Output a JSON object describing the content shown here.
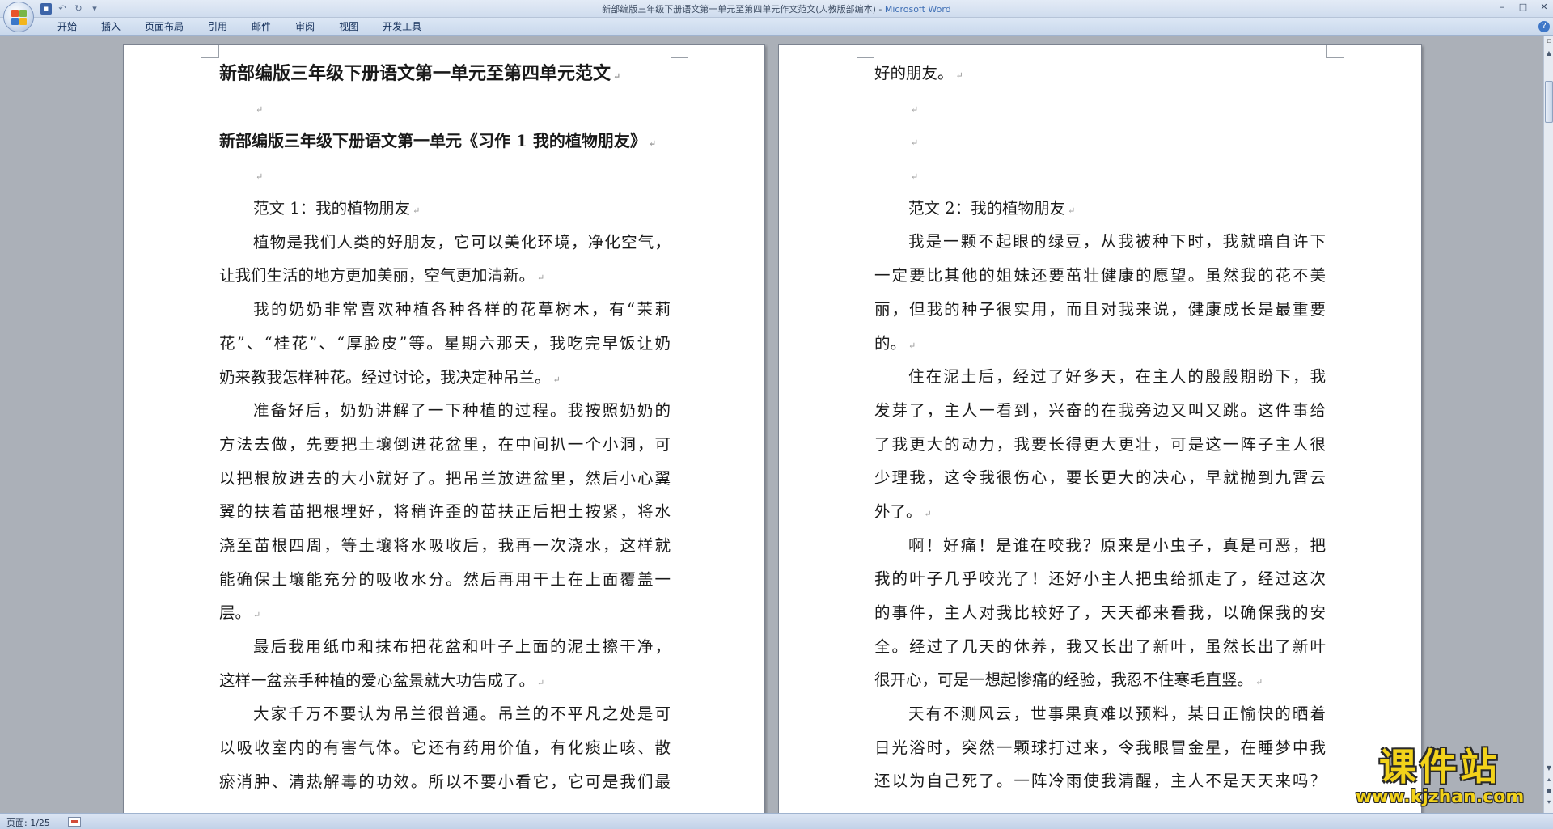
{
  "window": {
    "title": "新部编版三年级下册语文第一单元至第四单元作文范文(人教版部编本)",
    "app_name": "Microsoft Word",
    "separator": " - ",
    "minimize": "–",
    "maximize": "□",
    "close": "✕"
  },
  "quick_access": {
    "save": "▪",
    "undo": "↶",
    "redo": "↻",
    "customize": "▾"
  },
  "ribbon": {
    "tabs": [
      "开始",
      "插入",
      "页面布局",
      "引用",
      "邮件",
      "审阅",
      "视图",
      "开发工具"
    ],
    "help": "?"
  },
  "paragraph_mark": "↵",
  "page1": {
    "lines": [
      {
        "text": "新部编版三年级下册语文第一单元至第四单元范文",
        "style": "h1",
        "mark": true
      },
      {
        "text": "",
        "style": "indent",
        "mark": true
      },
      {
        "text": "新部编版三年级下册语文第一单元《习作 1 我的植物朋友》",
        "style": "h2",
        "mark": true
      },
      {
        "text": "",
        "style": "indent",
        "mark": true
      },
      {
        "text": "范文 1：我的植物朋友",
        "style": "indent",
        "mark": true
      },
      {
        "text": "植物是我们人类的好朋友，它可以美化环境，净化空气，",
        "style": "indent just",
        "mark": false
      },
      {
        "text": "让我们生活的地方更加美丽，空气更加清新。",
        "style": "",
        "mark": true
      },
      {
        "text": "我的奶奶非常喜欢种植各种各样的花草树木，有“茉莉",
        "style": "indent just",
        "mark": false
      },
      {
        "text": "花”、“桂花”、“厚脸皮”等。星期六那天，我吃完早饭让奶",
        "style": "just",
        "mark": false
      },
      {
        "text": "奶来教我怎样种花。经过讨论，我决定种吊兰。",
        "style": "",
        "mark": true
      },
      {
        "text": "准备好后，奶奶讲解了一下种植的过程。我按照奶奶的",
        "style": "indent just",
        "mark": false
      },
      {
        "text": "方法去做，先要把土壤倒进花盆里，在中间扒一个小洞，可",
        "style": "just",
        "mark": false
      },
      {
        "text": "以把根放进去的大小就好了。把吊兰放进盆里，然后小心翼",
        "style": "just",
        "mark": false
      },
      {
        "text": "翼的扶着苗把根埋好，将稍许歪的苗扶正后把土按紧，将水",
        "style": "just",
        "mark": false
      },
      {
        "text": "浇至苗根四周，等土壤将水吸收后，我再一次浇水，这样就",
        "style": "just",
        "mark": false
      },
      {
        "text": "能确保土壤能充分的吸收水分。然后再用干土在上面覆盖一",
        "style": "just",
        "mark": false
      },
      {
        "text": "层。",
        "style": "",
        "mark": true
      },
      {
        "text": "最后我用纸巾和抹布把花盆和叶子上面的泥土擦干净，",
        "style": "indent just",
        "mark": false
      },
      {
        "text": "这样一盆亲手种植的爱心盆景就大功告成了。",
        "style": "",
        "mark": true
      },
      {
        "text": "大家千万不要认为吊兰很普通。吊兰的不平凡之处是可",
        "style": "indent just",
        "mark": false
      },
      {
        "text": "以吸收室内的有害气体。它还有药用价值，有化痰止咳、散",
        "style": "just",
        "mark": false
      },
      {
        "text": "瘀消肿、清热解毒的功效。所以不要小看它，它可是我们最",
        "style": "just",
        "mark": false
      }
    ]
  },
  "page2": {
    "lines": [
      {
        "text": "好的朋友。",
        "style": "",
        "mark": true
      },
      {
        "text": "",
        "style": "indent",
        "mark": true
      },
      {
        "text": "",
        "style": "indent",
        "mark": true
      },
      {
        "text": "",
        "style": "indent",
        "mark": true
      },
      {
        "text": "范文 2：我的植物朋友",
        "style": "indent",
        "mark": true
      },
      {
        "text": "我是一颗不起眼的绿豆，从我被种下时，我就暗自许下",
        "style": "indent just",
        "mark": false
      },
      {
        "text": "一定要比其他的姐妹还要茁壮健康的愿望。虽然我的花不美",
        "style": "just",
        "mark": false
      },
      {
        "text": "丽，但我的种子很实用，而且对我来说，健康成长是最重要",
        "style": "just",
        "mark": false
      },
      {
        "text": "的。",
        "style": "",
        "mark": true
      },
      {
        "text": "住在泥土后，经过了好多天，在主人的殷殷期盼下，我",
        "style": "indent just",
        "mark": false
      },
      {
        "text": "发芽了，主人一看到，兴奋的在我旁边又叫又跳。这件事给",
        "style": "just",
        "mark": false
      },
      {
        "text": "了我更大的动力，我要长得更大更壮，可是这一阵子主人很",
        "style": "just",
        "mark": false
      },
      {
        "text": "少理我，这令我很伤心，要长更大的决心，早就抛到九霄云",
        "style": "just",
        "mark": false
      },
      {
        "text": "外了。",
        "style": "",
        "mark": true
      },
      {
        "text": "啊！好痛！是谁在咬我？原来是小虫子，真是可恶，把",
        "style": "indent just",
        "mark": false
      },
      {
        "text": "我的叶子几乎咬光了！还好小主人把虫给抓走了，经过这次",
        "style": "just",
        "mark": false
      },
      {
        "text": "的事件，主人对我比较好了，天天都来看我，以确保我的安",
        "style": "just",
        "mark": false
      },
      {
        "text": "全。经过了几天的休养，我又长出了新叶，虽然长出了新叶",
        "style": "just",
        "mark": false
      },
      {
        "text": "很开心，可是一想起惨痛的经验，我忍不住寒毛直竖。",
        "style": "",
        "mark": true
      },
      {
        "text": "天有不测风云，世事果真难以预料，某日正愉快的晒着",
        "style": "indent just",
        "mark": false
      },
      {
        "text": "日光浴时，突然一颗球打过来，令我眼冒金星，在睡梦中我",
        "style": "just",
        "mark": false
      },
      {
        "text": "还以为自己死了。一阵冷雨使我清醒，主人不是天天来吗？",
        "style": "just",
        "mark": false
      }
    ]
  },
  "statusbar": {
    "page_info": "页面: 1/25"
  },
  "watermark": {
    "name": "课件站",
    "url": "www.kjzhan.com"
  }
}
